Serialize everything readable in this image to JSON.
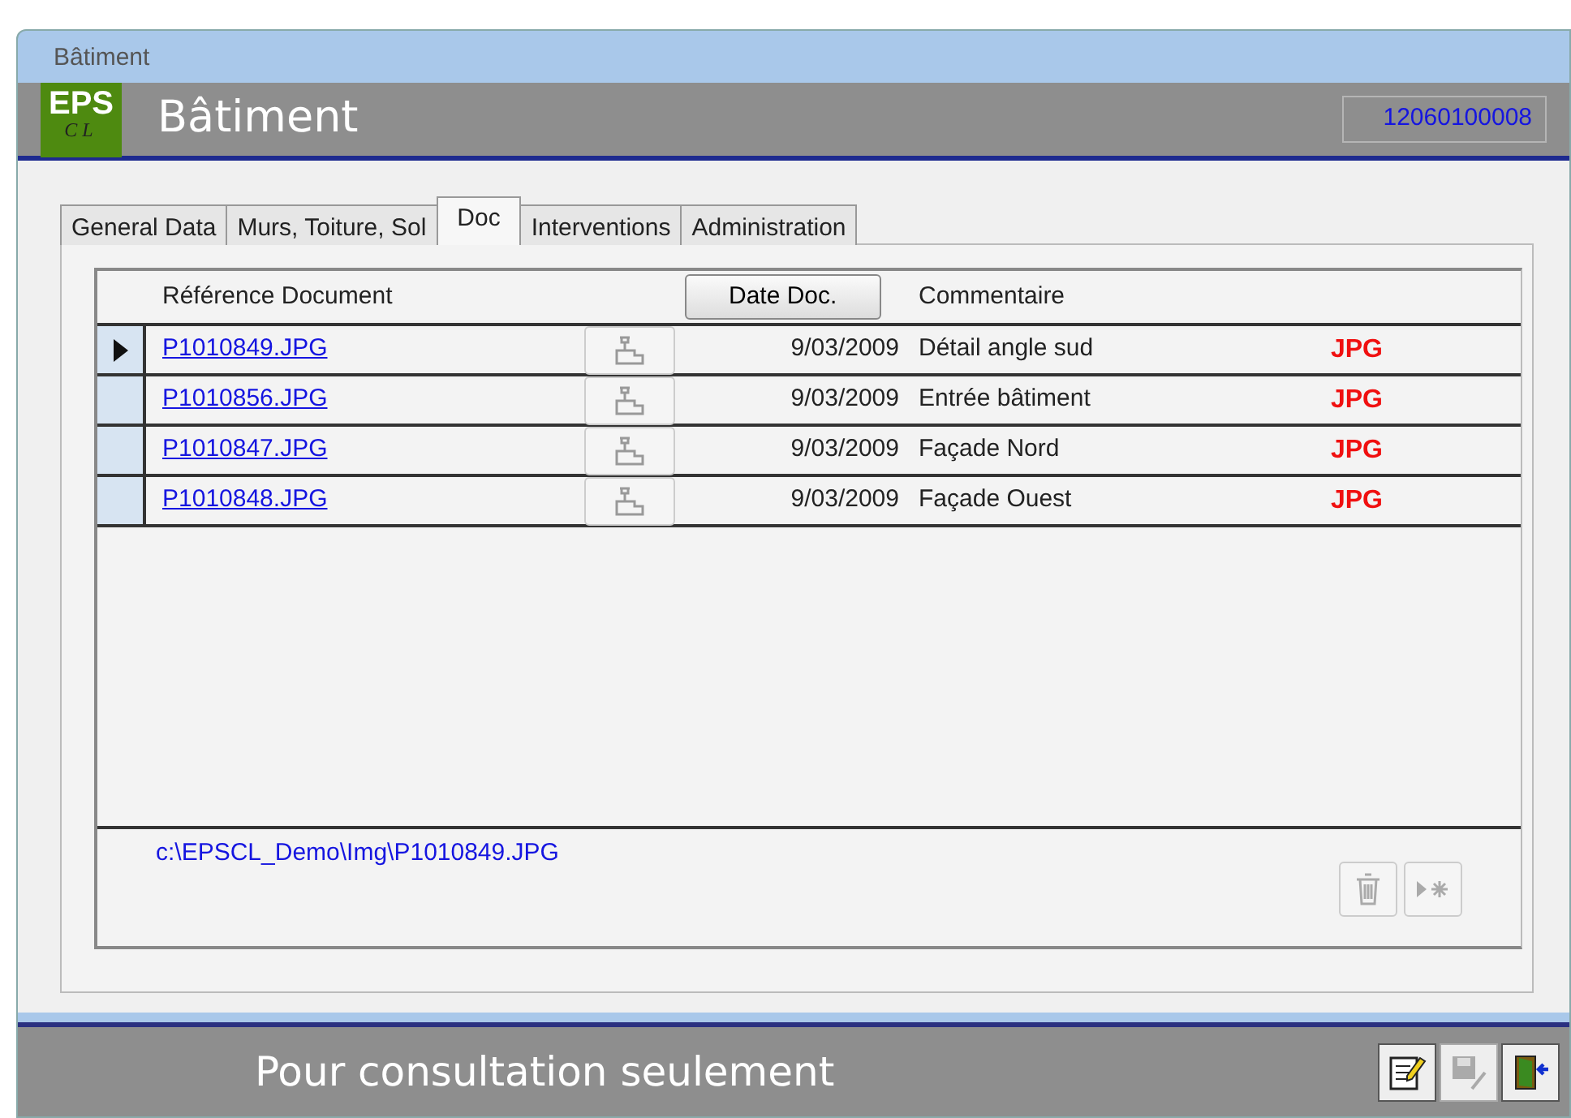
{
  "window": {
    "title": "Bâtiment"
  },
  "header": {
    "logo_top": "EPS",
    "logo_bottom": "CL",
    "title": "Bâtiment",
    "record_id": "12060100008"
  },
  "tabs": [
    {
      "label": "General Data",
      "selected": false
    },
    {
      "label": "Murs, Toiture, Sol",
      "selected": false
    },
    {
      "label": "Doc",
      "selected": true
    },
    {
      "label": "Interventions",
      "selected": false
    },
    {
      "label": "Administration",
      "selected": false
    }
  ],
  "grid": {
    "columns": [
      "Référence Document",
      "Date Doc.",
      "Commentaire"
    ],
    "rows": [
      {
        "reference": "P1010849.JPG",
        "date": "9/03/2009",
        "comment": "Détail angle sud",
        "type": "JPG",
        "selected": true
      },
      {
        "reference": "P1010856.JPG",
        "date": "9/03/2009",
        "comment": "Entrée bâtiment",
        "type": "JPG",
        "selected": false
      },
      {
        "reference": "P1010847.JPG",
        "date": "9/03/2009",
        "comment": "Façade Nord",
        "type": "JPG",
        "selected": false
      },
      {
        "reference": "P1010848.JPG",
        "date": "9/03/2009",
        "comment": "Façade Ouest",
        "type": "JPG",
        "selected": false
      }
    ],
    "path": "c:\\EPSCL_Demo\\Img\\P1010849.JPG",
    "tools": [
      {
        "kind": "delete",
        "disabled": true
      },
      {
        "kind": "new",
        "disabled": true
      }
    ]
  },
  "footer": {
    "message": "Pour consultation seulement",
    "buttons": [
      {
        "kind": "edit",
        "disabled": false
      },
      {
        "kind": "save",
        "disabled": true
      },
      {
        "kind": "exit",
        "disabled": false
      }
    ]
  }
}
